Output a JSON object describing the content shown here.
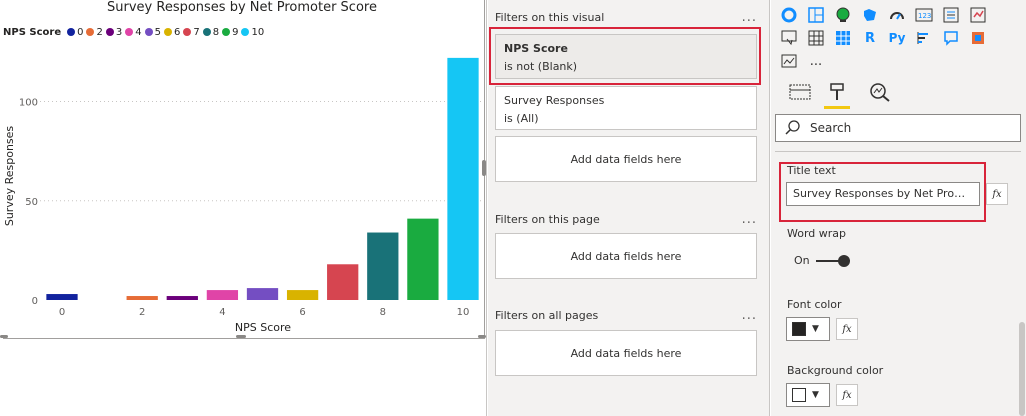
{
  "chart": {
    "title": "Survey Responses by Net Promoter Score",
    "legend_title": "NPS Score",
    "legend": [
      {
        "label": "0",
        "color": "#12239e"
      },
      {
        "label": "2",
        "color": "#e66c37"
      },
      {
        "label": "3",
        "color": "#6b007b"
      },
      {
        "label": "4",
        "color": "#e044a7"
      },
      {
        "label": "5",
        "color": "#744ec2"
      },
      {
        "label": "6",
        "color": "#d9b300"
      },
      {
        "label": "7",
        "color": "#d64550"
      },
      {
        "label": "8",
        "color": "#197278"
      },
      {
        "label": "9",
        "color": "#1aab40"
      },
      {
        "label": "10",
        "color": "#15c6f4"
      }
    ],
    "xlabel": "NPS Score",
    "ylabel": "Survey Responses"
  },
  "chart_data": {
    "type": "bar",
    "title": "Survey Responses by Net Promoter Score",
    "xlabel": "NPS Score",
    "ylabel": "Survey Responses",
    "x": [
      0,
      2,
      3,
      4,
      5,
      6,
      7,
      8,
      9,
      10
    ],
    "values": [
      3,
      2,
      2,
      5,
      6,
      5,
      18,
      34,
      41,
      122
    ],
    "colors": [
      "#12239e",
      "#e66c37",
      "#6b007b",
      "#e044a7",
      "#744ec2",
      "#d9b300",
      "#d64550",
      "#197278",
      "#1aab40",
      "#15c6f4"
    ],
    "xticks": [
      "0",
      "2",
      "4",
      "6",
      "8",
      "10"
    ],
    "yticks": [
      "0",
      "50",
      "100"
    ],
    "xlim": [
      0,
      10
    ],
    "ylim": [
      0,
      130
    ],
    "grid": true,
    "legend_position": "top-left"
  },
  "filters": {
    "visual_header": "Filters on this visual",
    "page_header": "Filters on this page",
    "all_header": "Filters on all pages",
    "more": "...",
    "visual_filters": [
      {
        "name": "NPS Score",
        "condition": "is not (Blank)"
      },
      {
        "name": "Survey Responses",
        "condition": "is (All)"
      }
    ],
    "add_label": "Add data fields here"
  },
  "format": {
    "viz_more": "...",
    "search_placeholder": "Search",
    "title_text_label": "Title text",
    "title_text_value": "Survey Responses by Net Promoter Score",
    "fx_label": "fx",
    "word_wrap_label": "Word wrap",
    "word_wrap_state": "On",
    "font_color_label": "Font color",
    "font_color": "#252423",
    "background_color_label": "Background color",
    "background_color": "#ffffff",
    "accent_color": "#f2c811",
    "highlight_color": "#d8243a"
  }
}
